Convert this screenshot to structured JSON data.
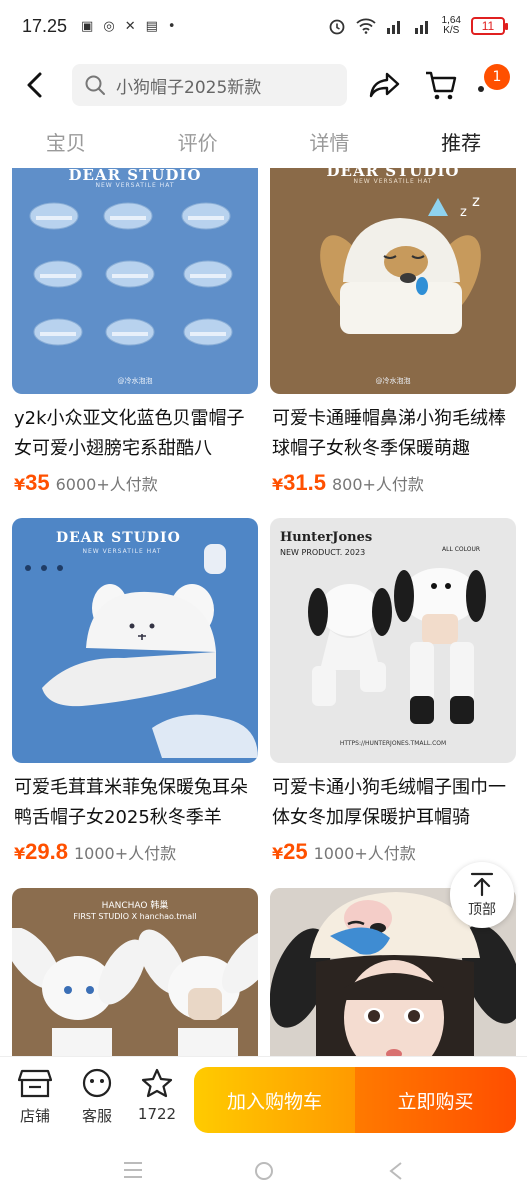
{
  "status": {
    "time": "17.25",
    "speed_top": "1,64",
    "speed_bottom": "K/S",
    "battery": "11"
  },
  "search": {
    "placeholder": "小狗帽子2025新款"
  },
  "cart_badge": "1",
  "tabs": [
    {
      "label": "宝贝",
      "active": false
    },
    {
      "label": "评价",
      "active": false
    },
    {
      "label": "详情",
      "active": false
    },
    {
      "label": "推荐",
      "active": true
    }
  ],
  "products": [
    {
      "title": "y2k小众亚文化蓝色贝雷帽子女可爱小翅膀宅系甜酷八",
      "yen": "¥",
      "price": "35",
      "sold": "6000+人付款",
      "brand": "DEAR STUDIO",
      "sub": "NEW VERSATILE HAT",
      "credit": "@冷水泡泡"
    },
    {
      "title": "可爱卡通睡帽鼻涕小狗毛绒棒球帽子女秋冬季保暖萌趣",
      "yen": "¥",
      "price": "31.5",
      "sold": "800+人付款",
      "brand": "DEAR STUDIO",
      "sub": "NEW VERSATILE HAT",
      "credit": "@冷水泡泡"
    },
    {
      "title": "可爱毛茸茸米菲兔保暖兔耳朵鸭舌帽子女2025秋冬季羊",
      "yen": "¥",
      "price": "29.8",
      "sold": "1000+人付款",
      "brand": "DEAR STUDIO",
      "sub": "NEW VERSATILE HAT"
    },
    {
      "title": "可爱卡通小狗毛绒帽子围巾一体女冬加厚保暖护耳帽骑",
      "yen": "¥",
      "price": "25",
      "sold": "1000+人付款",
      "brand": "HunterJones",
      "sub": "NEW PRODUCT. 2023",
      "tag": "ALL COLOUR",
      "url": "HTTPS://HUNTERJONES.TMALL.COM"
    },
    {
      "brand": "HANCHAO 韩巢",
      "sub": "FIRST STUDIO X hanchao.tmall"
    },
    {}
  ],
  "back_to_top": "顶部",
  "bottom": {
    "store": "店铺",
    "service": "客服",
    "fav_count": "1722",
    "add_cart": "加入购物车",
    "buy_now": "立即购买"
  },
  "colors": {
    "accent": "#ff5000",
    "cart_btn": "#ff9a00",
    "buy_btn": "#ff4e00"
  }
}
